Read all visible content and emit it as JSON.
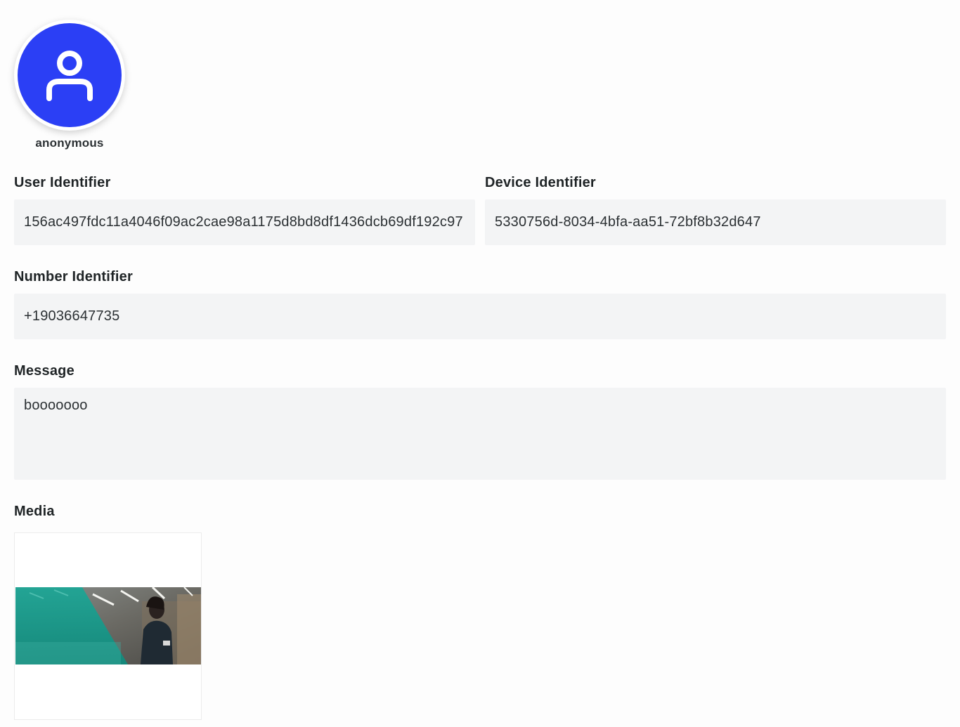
{
  "profile": {
    "name": "anonymous",
    "avatar_icon": "user-icon",
    "avatar_color": "#2b3ff5"
  },
  "fields": {
    "user_identifier": {
      "label": "User Identifier",
      "value": "156ac497fdc11a4046f09ac2cae98a1175d8bd8df1436dcb69df192c97"
    },
    "device_identifier": {
      "label": "Device Identifier",
      "value": "5330756d-8034-4bfa-aa51-72bf8b32d647"
    },
    "number_identifier": {
      "label": "Number Identifier",
      "value": "+19036647735"
    },
    "message": {
      "label": "Message",
      "value": "booooooo"
    }
  },
  "media": {
    "label": "Media",
    "thumbnail_description_icon": "image-thumbnail",
    "accent_color": "#1a9a8a"
  }
}
